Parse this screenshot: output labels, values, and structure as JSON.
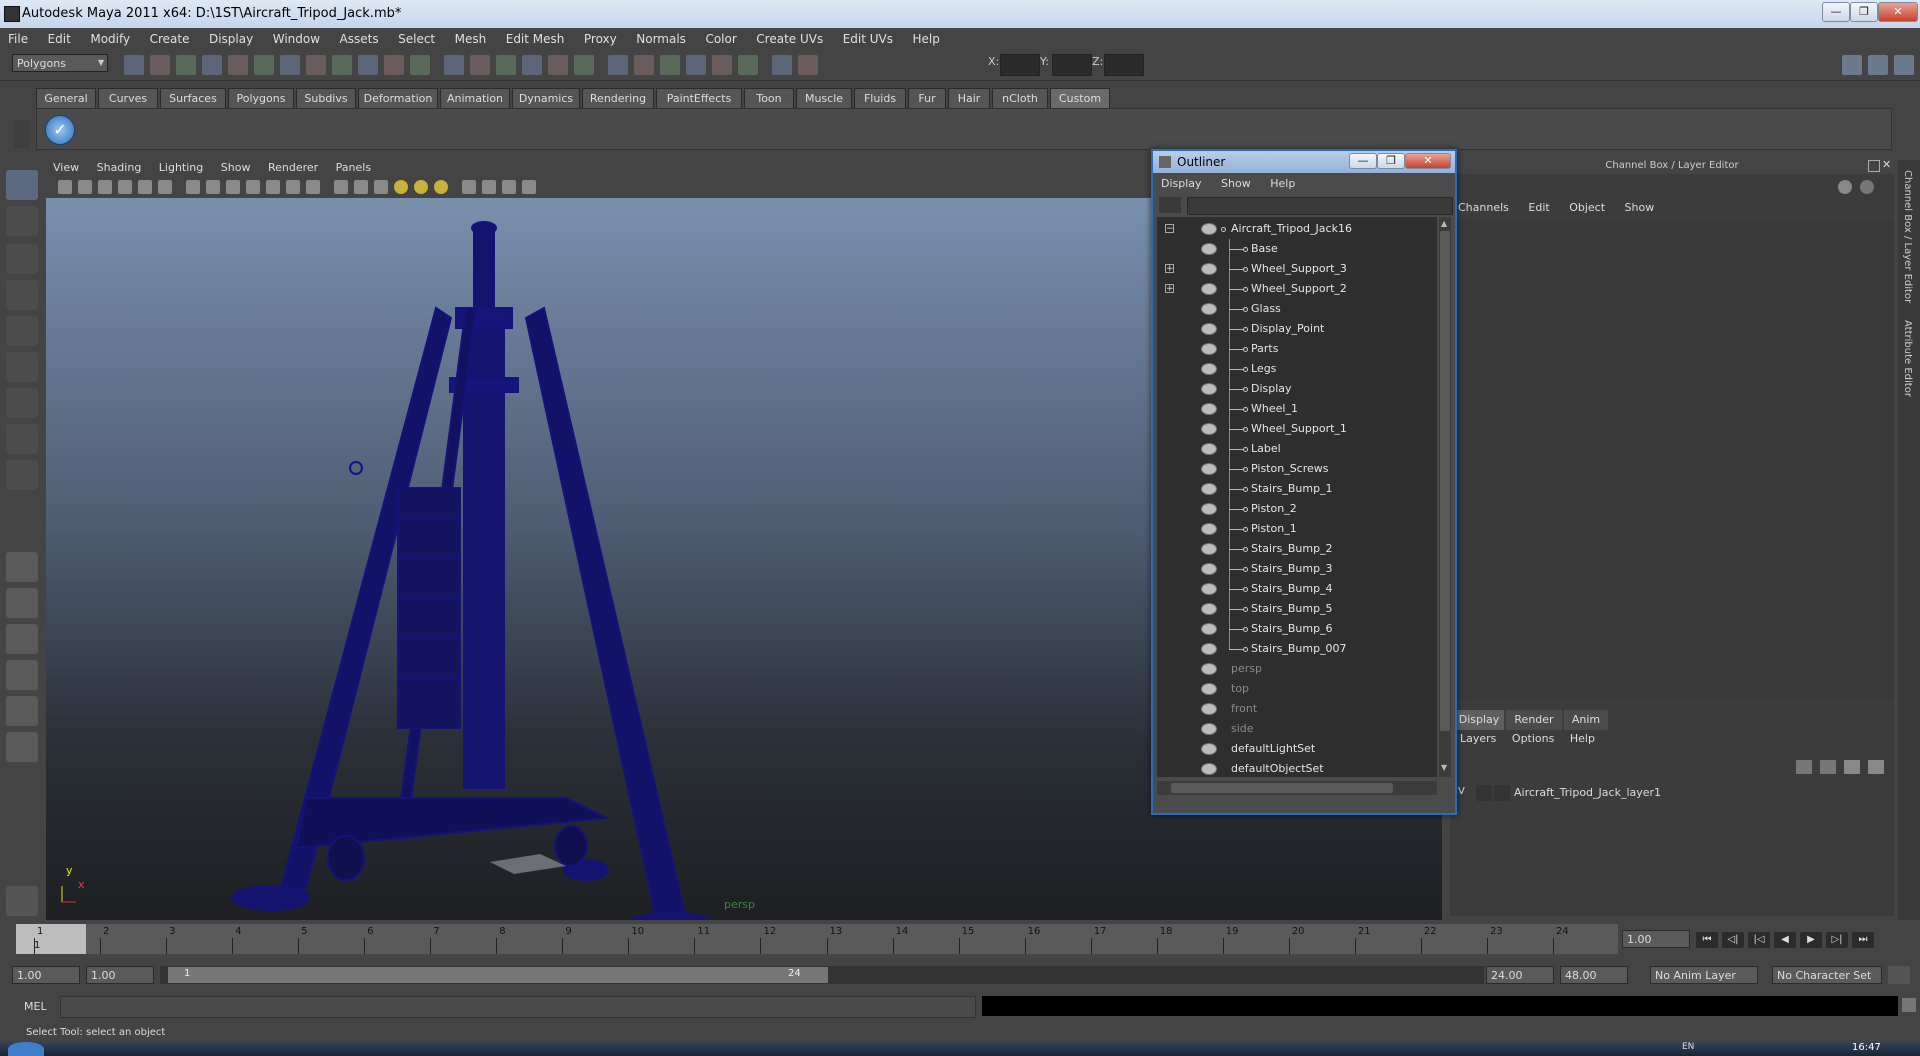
{
  "window": {
    "title": "Autodesk Maya 2011 x64: D:\\1ST\\Aircraft_Tripod_Jack.mb*",
    "min": "—",
    "max": "❐",
    "close": "✕"
  },
  "menubar": [
    "File",
    "Edit",
    "Modify",
    "Create",
    "Display",
    "Window",
    "Assets",
    "Select",
    "Mesh",
    "Edit Mesh",
    "Proxy",
    "Normals",
    "Color",
    "Create UVs",
    "Edit UVs",
    "Help"
  ],
  "statusline": {
    "mode": "Polygons",
    "x_label": "X:",
    "y_label": "Y:",
    "z_label": "Z:"
  },
  "shelf": {
    "tabs": [
      "General",
      "Curves",
      "Surfaces",
      "Polygons",
      "Subdivs",
      "Deformation",
      "Animation",
      "Dynamics",
      "Rendering",
      "PaintEffects",
      "Toon",
      "Muscle",
      "Fluids",
      "Fur",
      "Hair",
      "nCloth",
      "Custom"
    ],
    "active": "Custom"
  },
  "viewport": {
    "menu": [
      "View",
      "Shading",
      "Lighting",
      "Show",
      "Renderer",
      "Panels"
    ],
    "camera_label": "persp",
    "axis_y": "y",
    "axis_x": "x"
  },
  "outliner": {
    "title": "Outliner",
    "menu": [
      "Display",
      "Show",
      "Help"
    ],
    "items": [
      {
        "label": "Aircraft_Tripod_Jack16",
        "level": 0,
        "expander": "−",
        "dim": false
      },
      {
        "label": "Base",
        "level": 1,
        "expander": "",
        "dim": false
      },
      {
        "label": "Wheel_Support_3",
        "level": 1,
        "expander": "+",
        "dim": false
      },
      {
        "label": "Wheel_Support_2",
        "level": 1,
        "expander": "+",
        "dim": false
      },
      {
        "label": "Glass",
        "level": 1,
        "expander": "",
        "dim": false
      },
      {
        "label": "Display_Point",
        "level": 1,
        "expander": "",
        "dim": false
      },
      {
        "label": "Parts",
        "level": 1,
        "expander": "",
        "dim": false
      },
      {
        "label": "Legs",
        "level": 1,
        "expander": "",
        "dim": false
      },
      {
        "label": "Display",
        "level": 1,
        "expander": "",
        "dim": false
      },
      {
        "label": "Wheel_1",
        "level": 1,
        "expander": "",
        "dim": false
      },
      {
        "label": "Wheel_Support_1",
        "level": 1,
        "expander": "",
        "dim": false
      },
      {
        "label": "Label",
        "level": 1,
        "expander": "",
        "dim": false
      },
      {
        "label": "Piston_Screws",
        "level": 1,
        "expander": "",
        "dim": false
      },
      {
        "label": "Stairs_Bump_1",
        "level": 1,
        "expander": "",
        "dim": false
      },
      {
        "label": "Piston_2",
        "level": 1,
        "expander": "",
        "dim": false
      },
      {
        "label": "Piston_1",
        "level": 1,
        "expander": "",
        "dim": false
      },
      {
        "label": "Stairs_Bump_2",
        "level": 1,
        "expander": "",
        "dim": false
      },
      {
        "label": "Stairs_Bump_3",
        "level": 1,
        "expander": "",
        "dim": false
      },
      {
        "label": "Stairs_Bump_4",
        "level": 1,
        "expander": "",
        "dim": false
      },
      {
        "label": "Stairs_Bump_5",
        "level": 1,
        "expander": "",
        "dim": false
      },
      {
        "label": "Stairs_Bump_6",
        "level": 1,
        "expander": "",
        "dim": false
      },
      {
        "label": "Stairs_Bump_007",
        "level": 1,
        "expander": "",
        "dim": false
      },
      {
        "label": "persp",
        "level": 0,
        "expander": "",
        "dim": true
      },
      {
        "label": "top",
        "level": 0,
        "expander": "",
        "dim": true
      },
      {
        "label": "front",
        "level": 0,
        "expander": "",
        "dim": true
      },
      {
        "label": "side",
        "level": 0,
        "expander": "",
        "dim": true
      },
      {
        "label": "defaultLightSet",
        "level": 0,
        "expander": "",
        "dim": false
      },
      {
        "label": "defaultObjectSet",
        "level": 0,
        "expander": "",
        "dim": false
      }
    ]
  },
  "channelbox": {
    "title": "Channel Box / Layer Editor",
    "menu": [
      "Channels",
      "Edit",
      "Object",
      "Show"
    ]
  },
  "layer_editor": {
    "tabs": [
      "Display",
      "Render",
      "Anim"
    ],
    "active": "Display",
    "menu": [
      "Layers",
      "Options",
      "Help"
    ],
    "layer": {
      "visible": "V",
      "name": "Aircraft_Tripod_Jack_layer1"
    }
  },
  "side_tabs": [
    "Channel Box / Layer Editor",
    "Attribute Editor"
  ],
  "timeline": {
    "ticks": [
      "1",
      "2",
      "3",
      "4",
      "5",
      "6",
      "7",
      "8",
      "9",
      "10",
      "11",
      "12",
      "13",
      "14",
      "15",
      "16",
      "17",
      "18",
      "19",
      "20",
      "21",
      "22",
      "23",
      "24"
    ],
    "current": "1",
    "current_field": "1.00"
  },
  "range": {
    "start_outer": "1.00",
    "start_inner": "1.00",
    "slider_start": "1",
    "slider_end": "24",
    "end_inner": "24.00",
    "end_outer": "48.00",
    "anim_layer": "No Anim Layer",
    "char_set": "No Character Set"
  },
  "command": {
    "label": "MEL"
  },
  "help": {
    "text": "Select Tool: select an object"
  },
  "taskbar": {
    "clock": "16:47",
    "lang": "EN"
  },
  "colors": {
    "wireframe": "#13137a",
    "outliner_border": "#2c6cc0",
    "active_tab": "#6a6a6a"
  }
}
